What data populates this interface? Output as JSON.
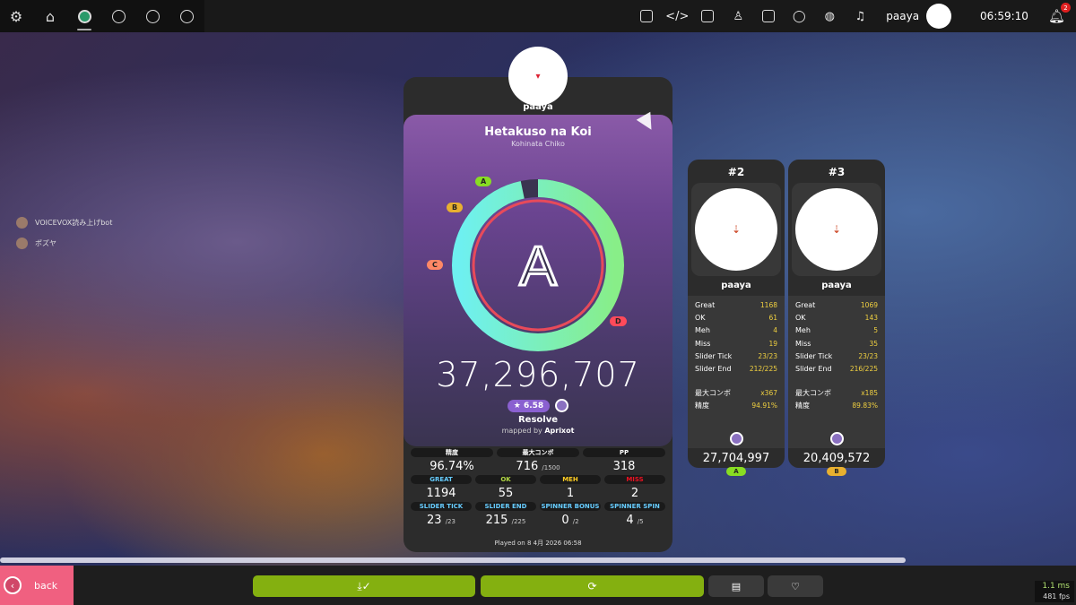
{
  "topbar": {
    "left_icons": [
      "settings-icon",
      "home-icon",
      "ruleset-osu-icon",
      "ruleset-taiko-icon",
      "ruleset-catch-icon",
      "ruleset-mania-icon"
    ],
    "right_icons": [
      "rss-icon",
      "code-icon",
      "book-icon",
      "ranking-icon",
      "beatmap-icon",
      "chat-icon",
      "globe-icon",
      "music-icon"
    ],
    "username": "paaya",
    "clock": "06:59:10",
    "notification_count": "2"
  },
  "chat": [
    {
      "text": "VOICEVOX読み上げbot"
    },
    {
      "text": "ポズヤ"
    }
  ],
  "main": {
    "username": "paaya",
    "title": "Hetakuso na Koi",
    "artist": "Kohinata Chiko",
    "grade": "A",
    "grade_markers": [
      "A",
      "B",
      "C",
      "D"
    ],
    "accuracy_fraction": 0.9674,
    "score": "37,296,707",
    "star_rating": "★ 6.58",
    "difficulty": "Resolve",
    "mapped_by_label": "mapped by",
    "mapper": "Aprixot",
    "stats_row1": [
      {
        "label": "精度",
        "value": "96.74%",
        "sub": "",
        "color": "#ffffff"
      },
      {
        "label": "最大コンボ",
        "value": "716",
        "sub": "/1500",
        "color": "#ffffff"
      },
      {
        "label": "PP",
        "value": "318",
        "sub": "",
        "color": "#ffffff"
      }
    ],
    "stats_row2": [
      {
        "label": "GREAT",
        "value": "1194",
        "color": "#66ccff"
      },
      {
        "label": "OK",
        "value": "55",
        "color": "#b3d944"
      },
      {
        "label": "MEH",
        "value": "1",
        "color": "#ffcc22"
      },
      {
        "label": "MISS",
        "value": "2",
        "color": "#ed1121"
      }
    ],
    "stats_row3": [
      {
        "label": "SLIDER TICK",
        "value": "23",
        "sub": "/23",
        "color": "#66ccff"
      },
      {
        "label": "SLIDER END",
        "value": "215",
        "sub": "/225",
        "color": "#66ccff"
      },
      {
        "label": "SPINNER BONUS",
        "value": "0",
        "sub": "/2",
        "color": "#66ccff"
      },
      {
        "label": "SPINNER SPIN",
        "value": "4",
        "sub": "/5",
        "color": "#66ccff"
      }
    ],
    "played_on": "Played on 8 4月 2026 06:58"
  },
  "others": [
    {
      "rank": "#2",
      "name": "paaya",
      "rows": [
        [
          "Great",
          "1168"
        ],
        [
          "OK",
          "61"
        ],
        [
          "Meh",
          "4"
        ],
        [
          "Miss",
          "19"
        ],
        [
          "Slider Tick",
          "23/23"
        ],
        [
          "Slider End",
          "212/225"
        ]
      ],
      "combo_label": "最大コンボ",
      "combo": "x367",
      "acc_label": "精度",
      "acc": "94.91%",
      "score": "27,704,997",
      "grade": "A",
      "grade_color": "#88dd22"
    },
    {
      "rank": "#3",
      "name": "paaya",
      "rows": [
        [
          "Great",
          "1069"
        ],
        [
          "OK",
          "143"
        ],
        [
          "Meh",
          "5"
        ],
        [
          "Miss",
          "35"
        ],
        [
          "Slider Tick",
          "23/23"
        ],
        [
          "Slider End",
          "216/225"
        ]
      ],
      "combo_label": "最大コンボ",
      "combo": "x185",
      "acc_label": "精度",
      "acc": "89.83%",
      "score": "20,409,572",
      "grade": "B",
      "grade_color": "#e8b030"
    }
  ],
  "bottom": {
    "back_label": "back",
    "perf_ms": "1.1 ms",
    "perf_fps": "481 fps"
  }
}
